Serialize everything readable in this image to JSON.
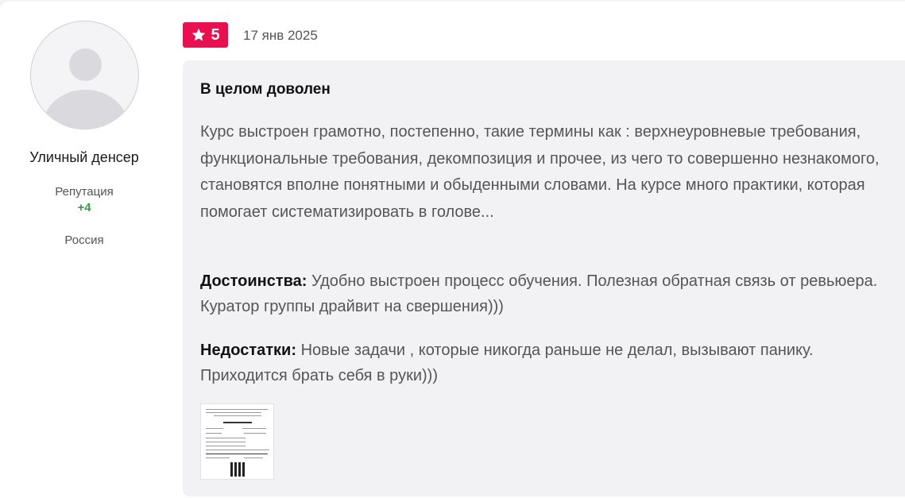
{
  "author": {
    "name": "Уличный денсер",
    "reputation_label": "Репутация",
    "reputation_value": "+4",
    "country": "Россия"
  },
  "review": {
    "rating": "5",
    "rating_icon": "star-icon",
    "date": "17 янв 2025",
    "title": "В целом доволен",
    "text": "Курс выстроен грамотно, постепенно, такие термины как : верхнеуровневые требования, функциональные требования, декомпозиция и прочее, из чего то совершенно незнакомого, становятся вполне понятными и обыденными словами. На курсе много практики, которая помогает систематизировать в голове...",
    "pros_label": "Достоинства:",
    "pros_text": " Удобно выстроен процесс обучения. Полезная обратная связь от ревьюера. Куратор группы драйвит на свершения)))",
    "cons_label": "Недостатки:",
    "cons_text": " Новые задачи , которые никогда раньше не делал, вызывают панику. Приходится брать себя в руки)))"
  },
  "colors": {
    "rating_bg": "#ea0f4e",
    "reputation": "#2ea043",
    "review_bg": "#f2f2f4"
  }
}
